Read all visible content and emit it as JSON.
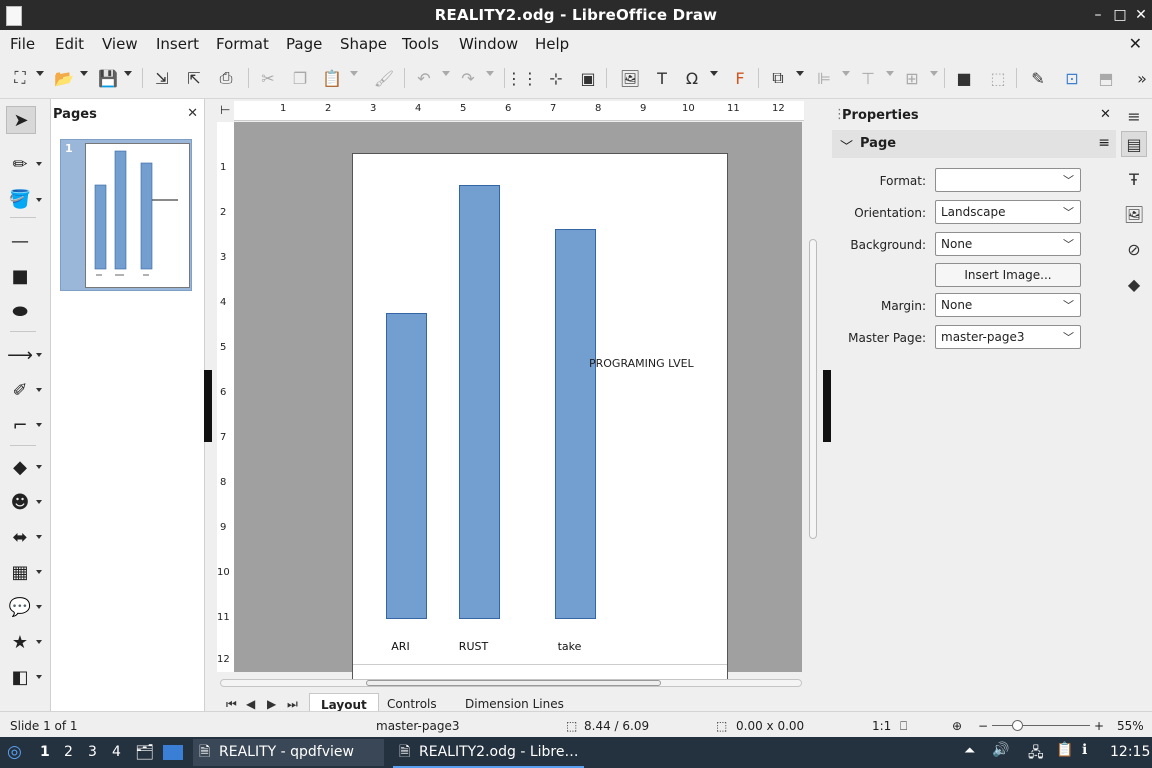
{
  "window": {
    "title": "REALITY2.odg - LibreOffice Draw",
    "buttons": [
      "minimize",
      "maximize",
      "close"
    ]
  },
  "menu": {
    "items": [
      "File",
      "Edit",
      "View",
      "Insert",
      "Format",
      "Page",
      "Shape",
      "Tools",
      "Window",
      "Help"
    ]
  },
  "pages_panel": {
    "title": "Pages",
    "thumb_number": "1"
  },
  "ruler": {
    "horizontal": [
      "1",
      "2",
      "3",
      "4",
      "5",
      "6",
      "7",
      "8",
      "9",
      "10",
      "11",
      "12"
    ],
    "vertical": [
      "1",
      "2",
      "3",
      "4",
      "5",
      "6",
      "7",
      "8",
      "9",
      "10",
      "11",
      "12"
    ]
  },
  "canvas": {
    "chart_text": "PROGRAMING LVEL"
  },
  "chart_data": {
    "type": "bar",
    "title": "PROGRAMING LVEL",
    "categories": [
      "ARI",
      "RUST",
      "take"
    ],
    "values": [
      6.9,
      9.8,
      8.8
    ],
    "ylim": [
      0,
      10
    ],
    "colors": {
      "bar": "#729fcf",
      "border": "#3465a4"
    }
  },
  "tabs": [
    "Layout",
    "Controls",
    "Dimension Lines"
  ],
  "properties": {
    "title": "Properties",
    "section": "Page",
    "format_label": "Format:",
    "format_value": "",
    "orientation_label": "Orientation:",
    "orientation_value": "Landscape",
    "background_label": "Background:",
    "background_value": "None",
    "insert_image": "Insert Image...",
    "margin_label": "Margin:",
    "margin_value": "None",
    "master_label": "Master Page:",
    "master_value": "master-page3"
  },
  "status": {
    "slide": "Slide 1 of 1",
    "master": "master-page3",
    "position": "8.44 / 6.09",
    "size": "0.00 x 0.00",
    "scale": "1:1",
    "zoom": "55%"
  },
  "taskbar": {
    "workspaces": [
      "1",
      "2",
      "3",
      "4"
    ],
    "tasks": [
      "REALITY - qpdfview",
      "REALITY2.odg - Libre…"
    ],
    "clock": "12:15"
  }
}
